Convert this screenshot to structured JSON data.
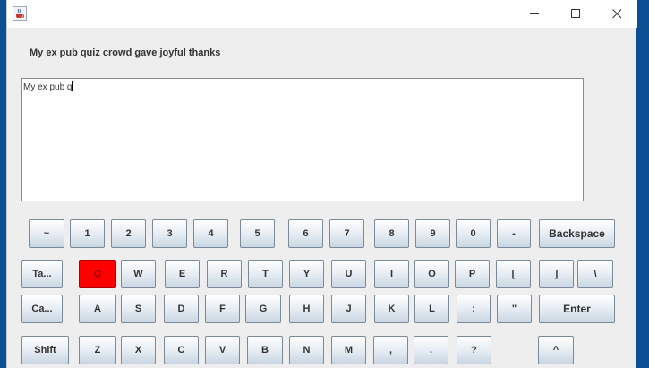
{
  "window": {
    "icon": "java-cup-icon",
    "controls": [
      "minimize-icon",
      "maximize-icon",
      "close-icon"
    ]
  },
  "prompt": "My ex pub quiz crowd gave joyful thanks",
  "typed_text": "My ex pub q",
  "highlight_color": "#ff0000",
  "keyboard": {
    "row1": [
      "~",
      "1",
      "2",
      "3",
      "4",
      "5",
      "6",
      "7",
      "8",
      "9",
      "0",
      "-",
      "Backspace"
    ],
    "row2": [
      "Ta...",
      "Q",
      "W",
      "E",
      "R",
      "T",
      "Y",
      "U",
      "I",
      "O",
      "P",
      "[",
      "]",
      "\\"
    ],
    "row3": [
      "Ca...",
      "A",
      "S",
      "D",
      "F",
      "G",
      "H",
      "J",
      "K",
      "L",
      ":",
      "\"",
      "Enter"
    ],
    "row4": [
      "Shift",
      "Z",
      "X",
      "C",
      "V",
      "B",
      "N",
      "M",
      ",",
      ".",
      "?",
      "^"
    ],
    "active_key": "Q"
  }
}
